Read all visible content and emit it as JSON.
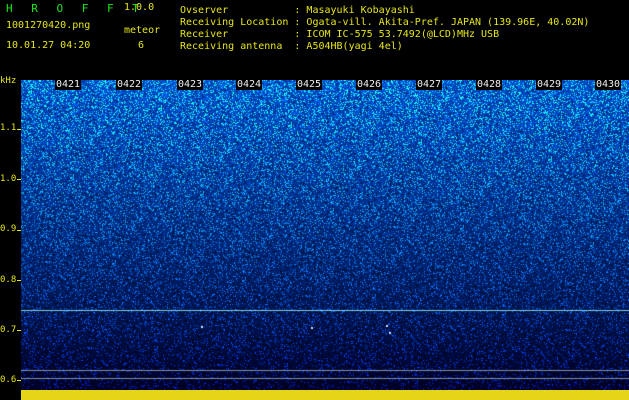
{
  "header": {
    "app_title": "H R O F F T",
    "version": "1.0.0",
    "filename": "1001270420.png",
    "datetime": "10.01.27 04:20",
    "meteor_label": "meteor",
    "meteor_count": "6",
    "info_lines": [
      "Ovserver           : Masayuki Kobayashi",
      "Receiving Location : Ogata-vill. Akita-Pref. JAPAN (139.96E, 40.02N)",
      "Receiver           : ICOM IC-575 53.7492(@LCD)MHz USB",
      "Receiving antenna  : A504HB(yagi 4el)"
    ]
  },
  "axis": {
    "unit": "kHz",
    "y_labels": [
      "1.1",
      "1.0",
      "0.9",
      "0.8",
      "0.7",
      "0.6"
    ]
  },
  "time_ticks": [
    "0421",
    "0422",
    "0423",
    "0424",
    "0425",
    "0426",
    "0427",
    "0428",
    "0429",
    "0430"
  ],
  "colors": {
    "text_yellow": "#e6e619",
    "title_green": "#19e619",
    "signal_line": "#7fd0e0"
  }
}
